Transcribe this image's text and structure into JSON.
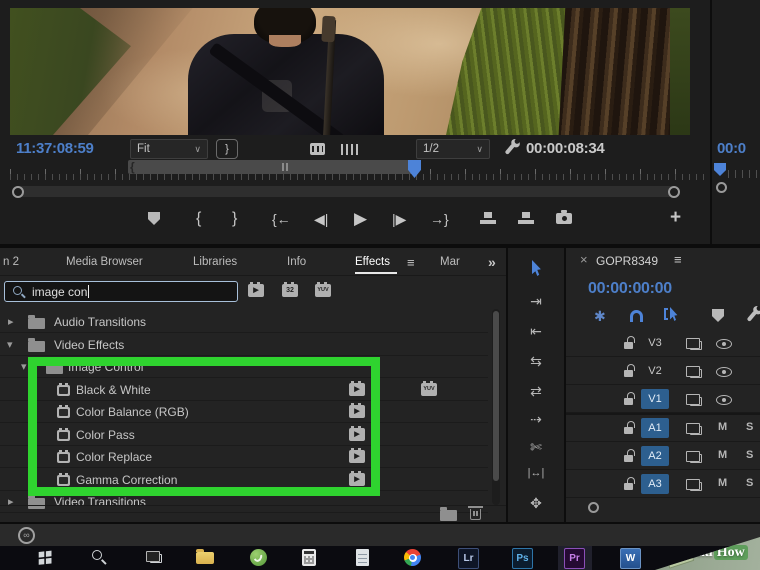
{
  "icons": {
    "tri_right": "▸",
    "tri_down": "▾",
    "chevron_down": "∨",
    "close": "×",
    "menu": "≡",
    "overflow": "»",
    "plus": "+",
    "mark_in": "{",
    "mark_out": "}",
    "go_in": "{←",
    "go_out": "→}",
    "step_back": "◀|",
    "play": "▶",
    "step_fwd": "|▶",
    "proxy_brace": "}",
    "badge_accel": "▶",
    "badge_32": "32",
    "badge_yuv": "YUV",
    "tool_track_select": "⇥",
    "tool_ripple": "⇤",
    "tool_rolling": "⇆",
    "tool_rate": "⇄",
    "tool_remix": "⇢",
    "tool_razor": "✄",
    "tool_slip": "|↔|",
    "tool_hand": "✥",
    "nest": "✱",
    "cc_infinity": "∞"
  },
  "source_monitor": {
    "current_timecode": "11:37:08:59",
    "zoom_level": "Fit",
    "playback_resolution": "1/2",
    "duration_timecode": "00:00:08:34"
  },
  "program_monitor": {
    "timecode_partial": "00:0"
  },
  "panel_tabs": [
    "n 2",
    "Media Browser",
    "Libraries",
    "Info",
    "Effects",
    "Mar"
  ],
  "effects": {
    "search_value": "image con",
    "tree": [
      {
        "label": "Audio Transitions"
      },
      {
        "label": "Video Effects"
      },
      {
        "label": "Image Control"
      },
      {
        "label": "Black & White"
      },
      {
        "label": "Color Balance (RGB)"
      },
      {
        "label": "Color Pass"
      },
      {
        "label": "Color Replace"
      },
      {
        "label": "Gamma Correction"
      },
      {
        "label": "Video Transitions"
      }
    ]
  },
  "timeline": {
    "tab_title": "GOPR8349",
    "timecode": "00:00:00:00",
    "tracks": [
      {
        "label": "V3"
      },
      {
        "label": "V2"
      },
      {
        "label": "V1"
      },
      {
        "label": "A1",
        "mute": "M",
        "solo": "S"
      },
      {
        "label": "A2",
        "mute": "M",
        "solo": "S"
      },
      {
        "label": "A3",
        "mute": "M",
        "solo": "S"
      }
    ]
  },
  "taskbar": {
    "apps": {
      "lightroom": "Lr",
      "photoshop": "Ps",
      "premiere": "Pr",
      "word": "W"
    }
  },
  "watermark": {
    "wiki": "wiki",
    "how": "How"
  },
  "colors": {
    "accent_blue": "#4d7fc9",
    "track_blue": "#2d5f8f",
    "highlight_green": "#2fd32f"
  }
}
